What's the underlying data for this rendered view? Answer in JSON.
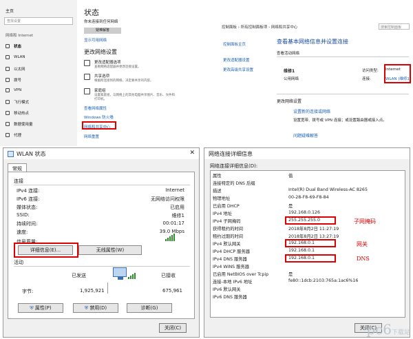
{
  "settings": {
    "home": "主页",
    "find_placeholder": "查找设置",
    "section": "网络和 Internet",
    "nav": [
      {
        "label": "状态",
        "icon": "home-icon",
        "active": true
      },
      {
        "label": "WLAN",
        "icon": "wifi-icon",
        "active": false
      },
      {
        "label": "以太网",
        "icon": "ethernet-icon",
        "active": false
      },
      {
        "label": "拨号",
        "icon": "dialup-icon",
        "active": false
      },
      {
        "label": "VPN",
        "icon": "vpn-icon",
        "active": false
      },
      {
        "label": "飞行模式",
        "icon": "airplane-icon",
        "active": false
      },
      {
        "label": "移动热点",
        "icon": "hotspot-icon",
        "active": false
      },
      {
        "label": "数据使用量",
        "icon": "data-usage-icon",
        "active": false
      },
      {
        "label": "代理",
        "icon": "proxy-icon",
        "active": false
      }
    ],
    "title": "状态",
    "status_line1": "你未连接到任何网络",
    "status_line2": "",
    "troubleshoot_btn": "疑难解答",
    "show_networks": "显示可用网络",
    "change_title": "更改网络设置",
    "options": [
      {
        "title": "更改适配器选项",
        "desc": "查看网络适配器并更改连接设置。"
      },
      {
        "title": "共享选项",
        "desc": "根据所连接到的网络，决定要共享的内容。"
      },
      {
        "title": "家庭组",
        "desc": "设置家庭组，与网络上的其他电脑共享图片、音乐、文件和打印机。"
      }
    ],
    "links": [
      "查看网络属性",
      "Windows 防火墙",
      "网络和共享中心",
      "网络重置"
    ]
  },
  "netcenter": {
    "breadcrumb": "控制面板 › 所有控制面板项 › 网络和共享中心",
    "search_placeholder": "搜索控制面板",
    "left_links": [
      "控制面板主页",
      "更改适配器设置",
      "更改高级共享设置"
    ],
    "title": "查看基本网络信息并设置连接",
    "active_networks": "查看活动网络",
    "network_name": "维修1",
    "network_type": "公用网络",
    "access_type_label": "访问类型:",
    "access_type_value": "Internet",
    "connection_label": "连接:",
    "connection_value": "WLAN (维修1)",
    "change_section": "更改网络设置",
    "setup_link": "设置新的连接或网络",
    "setup_desc": "设置宽带、拨号或 VPN 连接；或设置路由器或接入点。",
    "troubleshoot_link": "问题疑难解答"
  },
  "wlan": {
    "title": "WLAN 状态",
    "tab": "常规",
    "connection_group": "连接",
    "rows": [
      {
        "k": "IPv4 连接:",
        "v": "Internet"
      },
      {
        "k": "IPv6 连接:",
        "v": "无网络访问权限"
      },
      {
        "k": "媒体状态:",
        "v": "已启用"
      },
      {
        "k": "SSID:",
        "v": "维修1"
      },
      {
        "k": "持续时间:",
        "v": "00:01:17"
      },
      {
        "k": "速度:",
        "v": "39.0 Mbps"
      }
    ],
    "signal_label": "信号质量:",
    "signal_bars": 5,
    "details_btn": "详细信息(E)...",
    "wireless_btn": "无线属性(W)",
    "activity_group": "活动",
    "sent_label": "已发送",
    "recv_label": "已接收",
    "bytes_label": "字节:",
    "bytes_sent": "1,925,921",
    "bytes_recv": "675,961",
    "props_btn": "属性(P)",
    "disable_btn": "禁用(D)",
    "diagnose_btn": "诊断(G)",
    "close_btn": "关闭(C)"
  },
  "details": {
    "title": "网络连接详细信息",
    "label": "网络连接详细信息(D):",
    "header": {
      "p": "属性",
      "v": "值"
    },
    "rows": [
      {
        "p": "连接特定的 DNS 后缀",
        "v": ""
      },
      {
        "p": "描述",
        "v": "Intel(R) Dual Band Wireless-AC 8265"
      },
      {
        "p": "物理地址",
        "v": "00-28-F8-69-F8-84"
      },
      {
        "p": "已启用 DHCP",
        "v": "是"
      },
      {
        "p": "IPv4 地址",
        "v": "192.168.0.126"
      },
      {
        "p": "IPv4 子网掩码",
        "v": "255.255.255.0"
      },
      {
        "p": "获得租约的时间",
        "v": "2018年8月2日 11:27:19"
      },
      {
        "p": "租约过期的时间",
        "v": "2018年8月2日 13:27:19"
      },
      {
        "p": "IPv4 默认网关",
        "v": "192.168.0.1"
      },
      {
        "p": "IPv4 DHCP 服务器",
        "v": "192.168.0.1"
      },
      {
        "p": "IPv4 DNS 服务器",
        "v": "192.168.0.1"
      },
      {
        "p": "IPv4 WINS 服务器",
        "v": ""
      },
      {
        "p": "已启用 NetBIOS over Tcpip",
        "v": "是"
      },
      {
        "p": "连接-本地 IPv6 地址",
        "v": "fe80::1dcb:2103:765a:1ac6%16"
      },
      {
        "p": "IPv6 默认网关",
        "v": ""
      },
      {
        "p": "IPv6 DNS 服务器",
        "v": ""
      }
    ],
    "anno_subnet": "子网掩码",
    "anno_gateway": "网关",
    "anno_dns": "DNS",
    "close_btn": "关闭(C)"
  },
  "watermark": "pc6",
  "watermark_sub": "下载站"
}
